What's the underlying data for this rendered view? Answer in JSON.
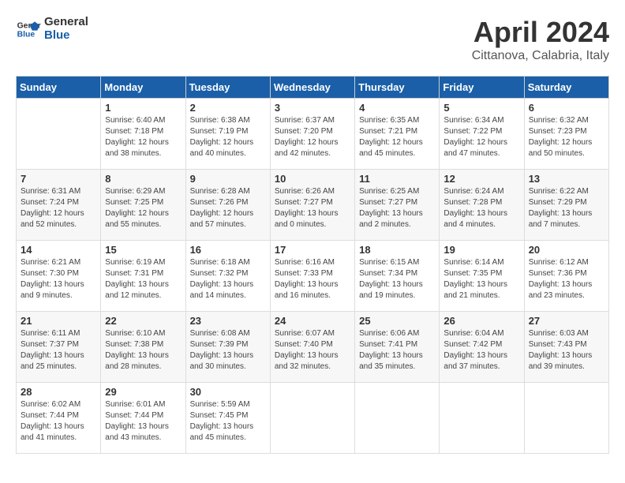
{
  "logo": {
    "line1": "General",
    "line2": "Blue"
  },
  "title": "April 2024",
  "subtitle": "Cittanova, Calabria, Italy",
  "days_header": [
    "Sunday",
    "Monday",
    "Tuesday",
    "Wednesday",
    "Thursday",
    "Friday",
    "Saturday"
  ],
  "weeks": [
    [
      {
        "day": "",
        "info": ""
      },
      {
        "day": "1",
        "info": "Sunrise: 6:40 AM\nSunset: 7:18 PM\nDaylight: 12 hours\nand 38 minutes."
      },
      {
        "day": "2",
        "info": "Sunrise: 6:38 AM\nSunset: 7:19 PM\nDaylight: 12 hours\nand 40 minutes."
      },
      {
        "day": "3",
        "info": "Sunrise: 6:37 AM\nSunset: 7:20 PM\nDaylight: 12 hours\nand 42 minutes."
      },
      {
        "day": "4",
        "info": "Sunrise: 6:35 AM\nSunset: 7:21 PM\nDaylight: 12 hours\nand 45 minutes."
      },
      {
        "day": "5",
        "info": "Sunrise: 6:34 AM\nSunset: 7:22 PM\nDaylight: 12 hours\nand 47 minutes."
      },
      {
        "day": "6",
        "info": "Sunrise: 6:32 AM\nSunset: 7:23 PM\nDaylight: 12 hours\nand 50 minutes."
      }
    ],
    [
      {
        "day": "7",
        "info": "Sunrise: 6:31 AM\nSunset: 7:24 PM\nDaylight: 12 hours\nand 52 minutes."
      },
      {
        "day": "8",
        "info": "Sunrise: 6:29 AM\nSunset: 7:25 PM\nDaylight: 12 hours\nand 55 minutes."
      },
      {
        "day": "9",
        "info": "Sunrise: 6:28 AM\nSunset: 7:26 PM\nDaylight: 12 hours\nand 57 minutes."
      },
      {
        "day": "10",
        "info": "Sunrise: 6:26 AM\nSunset: 7:27 PM\nDaylight: 13 hours\nand 0 minutes."
      },
      {
        "day": "11",
        "info": "Sunrise: 6:25 AM\nSunset: 7:27 PM\nDaylight: 13 hours\nand 2 minutes."
      },
      {
        "day": "12",
        "info": "Sunrise: 6:24 AM\nSunset: 7:28 PM\nDaylight: 13 hours\nand 4 minutes."
      },
      {
        "day": "13",
        "info": "Sunrise: 6:22 AM\nSunset: 7:29 PM\nDaylight: 13 hours\nand 7 minutes."
      }
    ],
    [
      {
        "day": "14",
        "info": "Sunrise: 6:21 AM\nSunset: 7:30 PM\nDaylight: 13 hours\nand 9 minutes."
      },
      {
        "day": "15",
        "info": "Sunrise: 6:19 AM\nSunset: 7:31 PM\nDaylight: 13 hours\nand 12 minutes."
      },
      {
        "day": "16",
        "info": "Sunrise: 6:18 AM\nSunset: 7:32 PM\nDaylight: 13 hours\nand 14 minutes."
      },
      {
        "day": "17",
        "info": "Sunrise: 6:16 AM\nSunset: 7:33 PM\nDaylight: 13 hours\nand 16 minutes."
      },
      {
        "day": "18",
        "info": "Sunrise: 6:15 AM\nSunset: 7:34 PM\nDaylight: 13 hours\nand 19 minutes."
      },
      {
        "day": "19",
        "info": "Sunrise: 6:14 AM\nSunset: 7:35 PM\nDaylight: 13 hours\nand 21 minutes."
      },
      {
        "day": "20",
        "info": "Sunrise: 6:12 AM\nSunset: 7:36 PM\nDaylight: 13 hours\nand 23 minutes."
      }
    ],
    [
      {
        "day": "21",
        "info": "Sunrise: 6:11 AM\nSunset: 7:37 PM\nDaylight: 13 hours\nand 25 minutes."
      },
      {
        "day": "22",
        "info": "Sunrise: 6:10 AM\nSunset: 7:38 PM\nDaylight: 13 hours\nand 28 minutes."
      },
      {
        "day": "23",
        "info": "Sunrise: 6:08 AM\nSunset: 7:39 PM\nDaylight: 13 hours\nand 30 minutes."
      },
      {
        "day": "24",
        "info": "Sunrise: 6:07 AM\nSunset: 7:40 PM\nDaylight: 13 hours\nand 32 minutes."
      },
      {
        "day": "25",
        "info": "Sunrise: 6:06 AM\nSunset: 7:41 PM\nDaylight: 13 hours\nand 35 minutes."
      },
      {
        "day": "26",
        "info": "Sunrise: 6:04 AM\nSunset: 7:42 PM\nDaylight: 13 hours\nand 37 minutes."
      },
      {
        "day": "27",
        "info": "Sunrise: 6:03 AM\nSunset: 7:43 PM\nDaylight: 13 hours\nand 39 minutes."
      }
    ],
    [
      {
        "day": "28",
        "info": "Sunrise: 6:02 AM\nSunset: 7:44 PM\nDaylight: 13 hours\nand 41 minutes."
      },
      {
        "day": "29",
        "info": "Sunrise: 6:01 AM\nSunset: 7:44 PM\nDaylight: 13 hours\nand 43 minutes."
      },
      {
        "day": "30",
        "info": "Sunrise: 5:59 AM\nSunset: 7:45 PM\nDaylight: 13 hours\nand 45 minutes."
      },
      {
        "day": "",
        "info": ""
      },
      {
        "day": "",
        "info": ""
      },
      {
        "day": "",
        "info": ""
      },
      {
        "day": "",
        "info": ""
      }
    ]
  ]
}
